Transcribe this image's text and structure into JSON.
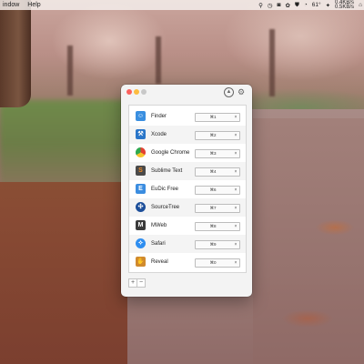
{
  "menubar": {
    "items": [
      "indow",
      "Help"
    ],
    "status": {
      "temperature": "61°",
      "network_up": "0.4KB/s",
      "network_down": "0.5KB/s"
    }
  },
  "window": {
    "up_icon": "up-arrow-icon",
    "gear_icon": "gear-icon",
    "apps": [
      {
        "name": "Finder",
        "shortcut": "⌘1",
        "icon": "finder-icon",
        "color": "#3a8fe0"
      },
      {
        "name": "Xcode",
        "shortcut": "⌘2",
        "icon": "xcode-icon",
        "color": "#2a76c9"
      },
      {
        "name": "Google Chrome",
        "shortcut": "⌘3",
        "icon": "chrome-icon",
        "color": "#e34133"
      },
      {
        "name": "Sublime Text",
        "shortcut": "⌘4",
        "icon": "sublime-icon",
        "color": "#4a4a4a"
      },
      {
        "name": "EuDic Free",
        "shortcut": "⌘6",
        "icon": "eudic-icon",
        "color": "#3b8de0"
      },
      {
        "name": "SourceTree",
        "shortcut": "⌘7",
        "icon": "sourcetree-icon",
        "color": "#1d4f9a"
      },
      {
        "name": "MWeb",
        "shortcut": "⌘8",
        "icon": "mweb-icon",
        "color": "#3b3b3b"
      },
      {
        "name": "Safari",
        "shortcut": "⌘9",
        "icon": "safari-icon",
        "color": "#2f8ef0"
      },
      {
        "name": "Reveal",
        "shortcut": "⌘0",
        "icon": "reveal-icon",
        "color": "#d08a2e"
      }
    ],
    "clear_label": "×",
    "add_label": "+",
    "remove_label": "−"
  }
}
